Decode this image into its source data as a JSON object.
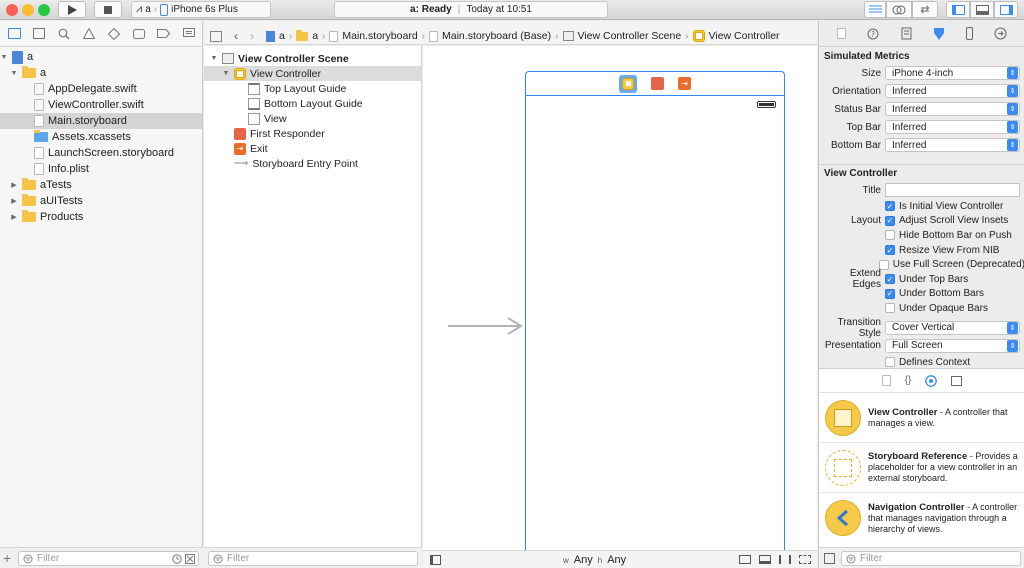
{
  "toolbar": {
    "scheme_target": "a",
    "scheme_device": "iPhone 6s Plus",
    "activity_status": "a: Ready",
    "activity_time": "Today at 10:51"
  },
  "navigator": {
    "items": [
      {
        "label": "a",
        "kind": "project",
        "level": 0,
        "disclosure": "▼"
      },
      {
        "label": "a",
        "kind": "folder",
        "level": 1,
        "disclosure": "▼"
      },
      {
        "label": "AppDelegate.swift",
        "kind": "file",
        "level": 2
      },
      {
        "label": "ViewController.swift",
        "kind": "file",
        "level": 2
      },
      {
        "label": "Main.storyboard",
        "kind": "file",
        "level": 2,
        "selected": true
      },
      {
        "label": "Assets.xcassets",
        "kind": "folder-blue",
        "level": 2
      },
      {
        "label": "LaunchScreen.storyboard",
        "kind": "file",
        "level": 2
      },
      {
        "label": "Info.plist",
        "kind": "file",
        "level": 2
      },
      {
        "label": "aTests",
        "kind": "folder",
        "level": 1,
        "disclosure": "▶"
      },
      {
        "label": "aUITests",
        "kind": "folder",
        "level": 1,
        "disclosure": "▶"
      },
      {
        "label": "Products",
        "kind": "folder",
        "level": 1,
        "disclosure": "▶"
      }
    ],
    "filter_placeholder": "Filter"
  },
  "jumpbar": {
    "crumbs": [
      "a",
      "a",
      "Main.storyboard",
      "Main.storyboard (Base)",
      "View Controller Scene",
      "View Controller"
    ]
  },
  "outline": {
    "scene_title": "View Controller Scene",
    "items": [
      {
        "label": "View Controller",
        "icon": "vc",
        "level": 1,
        "selected": true,
        "disclosure": "▼"
      },
      {
        "label": "Top Layout Guide",
        "icon": "guide-top",
        "level": 2
      },
      {
        "label": "Bottom Layout Guide",
        "icon": "guide-bottom",
        "level": 2
      },
      {
        "label": "View",
        "icon": "view",
        "level": 2
      },
      {
        "label": "First Responder",
        "icon": "cube",
        "level": 0
      },
      {
        "label": "Exit",
        "icon": "exit",
        "level": 0
      },
      {
        "label": "Storyboard Entry Point",
        "icon": "arrow",
        "level": 0
      }
    ],
    "filter_placeholder": "Filter"
  },
  "canvas": {
    "size_class_w_prefix": "w",
    "size_class_w": "Any",
    "size_class_h_prefix": "h",
    "size_class_h": "Any"
  },
  "inspector": {
    "simulated_metrics_title": "Simulated Metrics",
    "metrics": [
      {
        "label": "Size",
        "value": "iPhone 4-inch"
      },
      {
        "label": "Orientation",
        "value": "Inferred"
      },
      {
        "label": "Status Bar",
        "value": "Inferred"
      },
      {
        "label": "Top Bar",
        "value": "Inferred"
      },
      {
        "label": "Bottom Bar",
        "value": "Inferred"
      }
    ],
    "vc_title": "View Controller",
    "title_label": "Title",
    "title_value": "",
    "checks": [
      {
        "group": "",
        "label": "Is Initial View Controller",
        "checked": true
      },
      {
        "group": "Layout",
        "label": "Adjust Scroll View Insets",
        "checked": true
      },
      {
        "group": "",
        "label": "Hide Bottom Bar on Push",
        "checked": false
      },
      {
        "group": "",
        "label": "Resize View From NIB",
        "checked": true
      },
      {
        "group": "",
        "label": "Use Full Screen (Deprecated)",
        "checked": false
      },
      {
        "group": "Extend Edges",
        "label": "Under Top Bars",
        "checked": true
      },
      {
        "group": "",
        "label": "Under Bottom Bars",
        "checked": true
      },
      {
        "group": "",
        "label": "Under Opaque Bars",
        "checked": false
      }
    ],
    "transition_label": "Transition Style",
    "transition_value": "Cover Vertical",
    "presentation_label": "Presentation",
    "presentation_value": "Full Screen",
    "defines_context_label": "Defines Context"
  },
  "library": {
    "items": [
      {
        "name": "View Controller",
        "desc": " - A controller that manages a view.",
        "icon": "vc"
      },
      {
        "name": "Storyboard Reference",
        "desc": " - Provides a placeholder for a view controller in an external storyboard.",
        "icon": "ref"
      },
      {
        "name": "Navigation Controller",
        "desc": " - A controller that manages navigation through a hierarchy of views.",
        "icon": "nav"
      }
    ],
    "filter_placeholder": "Filter"
  },
  "colors": {
    "accent": "#3a8bf3",
    "selection_border": "#2b8af7",
    "vc_yellow": "#f7c948",
    "first_responder": "#e7644a",
    "exit": "#ea6b2c"
  }
}
